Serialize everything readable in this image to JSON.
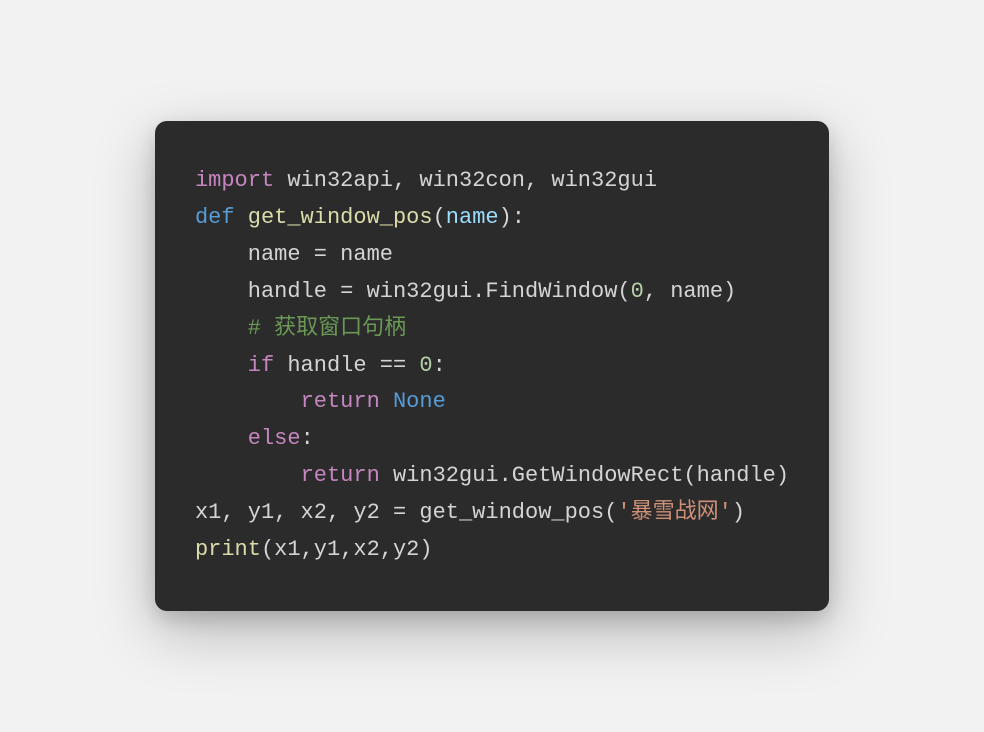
{
  "code": {
    "line1": {
      "import": "import",
      "modules": " win32api, win32con, win32gui"
    },
    "line2": {
      "def": "def",
      "fname": " get_window_pos",
      "open": "(",
      "param": "name",
      "close": "):"
    },
    "line3": {
      "indent": "    ",
      "left": "name = name"
    },
    "line4": {
      "indent": "    ",
      "left": "handle = win32gui.FindWindow(",
      "zero": "0",
      "mid": ", name)"
    },
    "line5": {
      "indent": "    ",
      "comment": "# 获取窗口句柄"
    },
    "line6": {
      "indent": "    ",
      "if": "if",
      "cond": " handle == ",
      "zero": "0",
      "colon": ":"
    },
    "line7": {
      "indent": "        ",
      "return": "return",
      "sp": " ",
      "none": "None"
    },
    "line8": {
      "indent": "    ",
      "else": "else",
      "colon": ":"
    },
    "line9": {
      "indent": "        ",
      "return": "return",
      "rest": " win32gui.GetWindowRect(handle)"
    },
    "line10": {
      "left": "x1, y1, x2, y2 = get_window_pos(",
      "str": "'暴雪战网'",
      "close": ")"
    },
    "line11": {
      "print": "print",
      "args": "(x1,y1,x2,y2)"
    }
  }
}
